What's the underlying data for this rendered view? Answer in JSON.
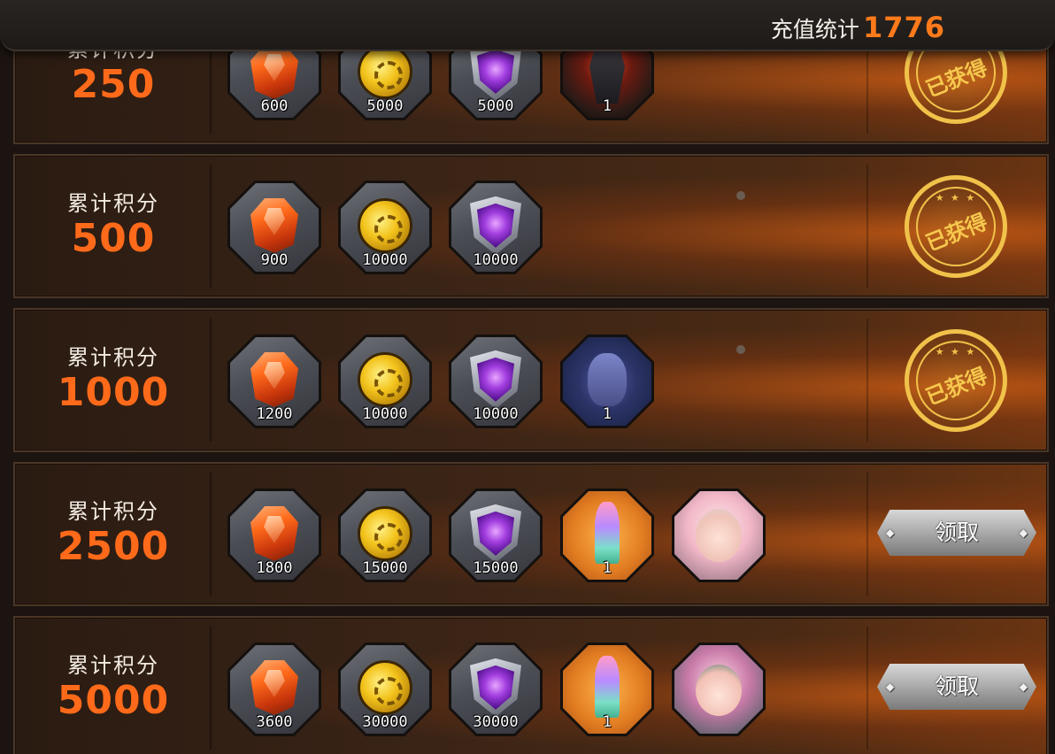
{
  "header": {
    "stat_label": "充值统计",
    "stat_value": "1776"
  },
  "rows": [
    {
      "score_label": "累计积分",
      "score_value": "250",
      "status": "claimed",
      "stamp_text": "已获得",
      "items": [
        {
          "icon": "gem-icon",
          "amount": "600"
        },
        {
          "icon": "coin-icon",
          "amount": "5000"
        },
        {
          "icon": "purple-shield-icon",
          "amount": "5000"
        },
        {
          "icon": "mech-hero-portrait",
          "amount": "1"
        }
      ]
    },
    {
      "score_label": "累计积分",
      "score_value": "500",
      "status": "claimed",
      "stamp_text": "已获得",
      "items": [
        {
          "icon": "gem-icon",
          "amount": "900"
        },
        {
          "icon": "coin-icon",
          "amount": "10000"
        },
        {
          "icon": "purple-shield-icon",
          "amount": "10000"
        }
      ]
    },
    {
      "score_label": "累计积分",
      "score_value": "1000",
      "status": "claimed",
      "stamp_text": "已获得",
      "items": [
        {
          "icon": "gem-icon",
          "amount": "1200"
        },
        {
          "icon": "coin-icon",
          "amount": "10000"
        },
        {
          "icon": "purple-shield-icon",
          "amount": "10000"
        },
        {
          "icon": "elf-hero-portrait",
          "amount": "1"
        }
      ]
    },
    {
      "score_label": "累计积分",
      "score_value": "2500",
      "status": "claimable",
      "button_label": "领取",
      "items": [
        {
          "icon": "gem-icon",
          "amount": "1800"
        },
        {
          "icon": "coin-icon",
          "amount": "15000"
        },
        {
          "icon": "purple-shield-icon",
          "amount": "15000"
        },
        {
          "icon": "crystal-statue-icon",
          "amount": "1"
        },
        {
          "icon": "girl-hero-portrait",
          "amount": ""
        }
      ]
    },
    {
      "score_label": "累计积分",
      "score_value": "5000",
      "status": "claimable",
      "button_label": "领取",
      "items": [
        {
          "icon": "gem-icon",
          "amount": "3600"
        },
        {
          "icon": "coin-icon",
          "amount": "30000"
        },
        {
          "icon": "purple-shield-icon",
          "amount": "30000"
        },
        {
          "icon": "crystal-statue-icon",
          "amount": "1"
        },
        {
          "icon": "girl-hero-portrait-2",
          "amount": ""
        }
      ]
    }
  ]
}
